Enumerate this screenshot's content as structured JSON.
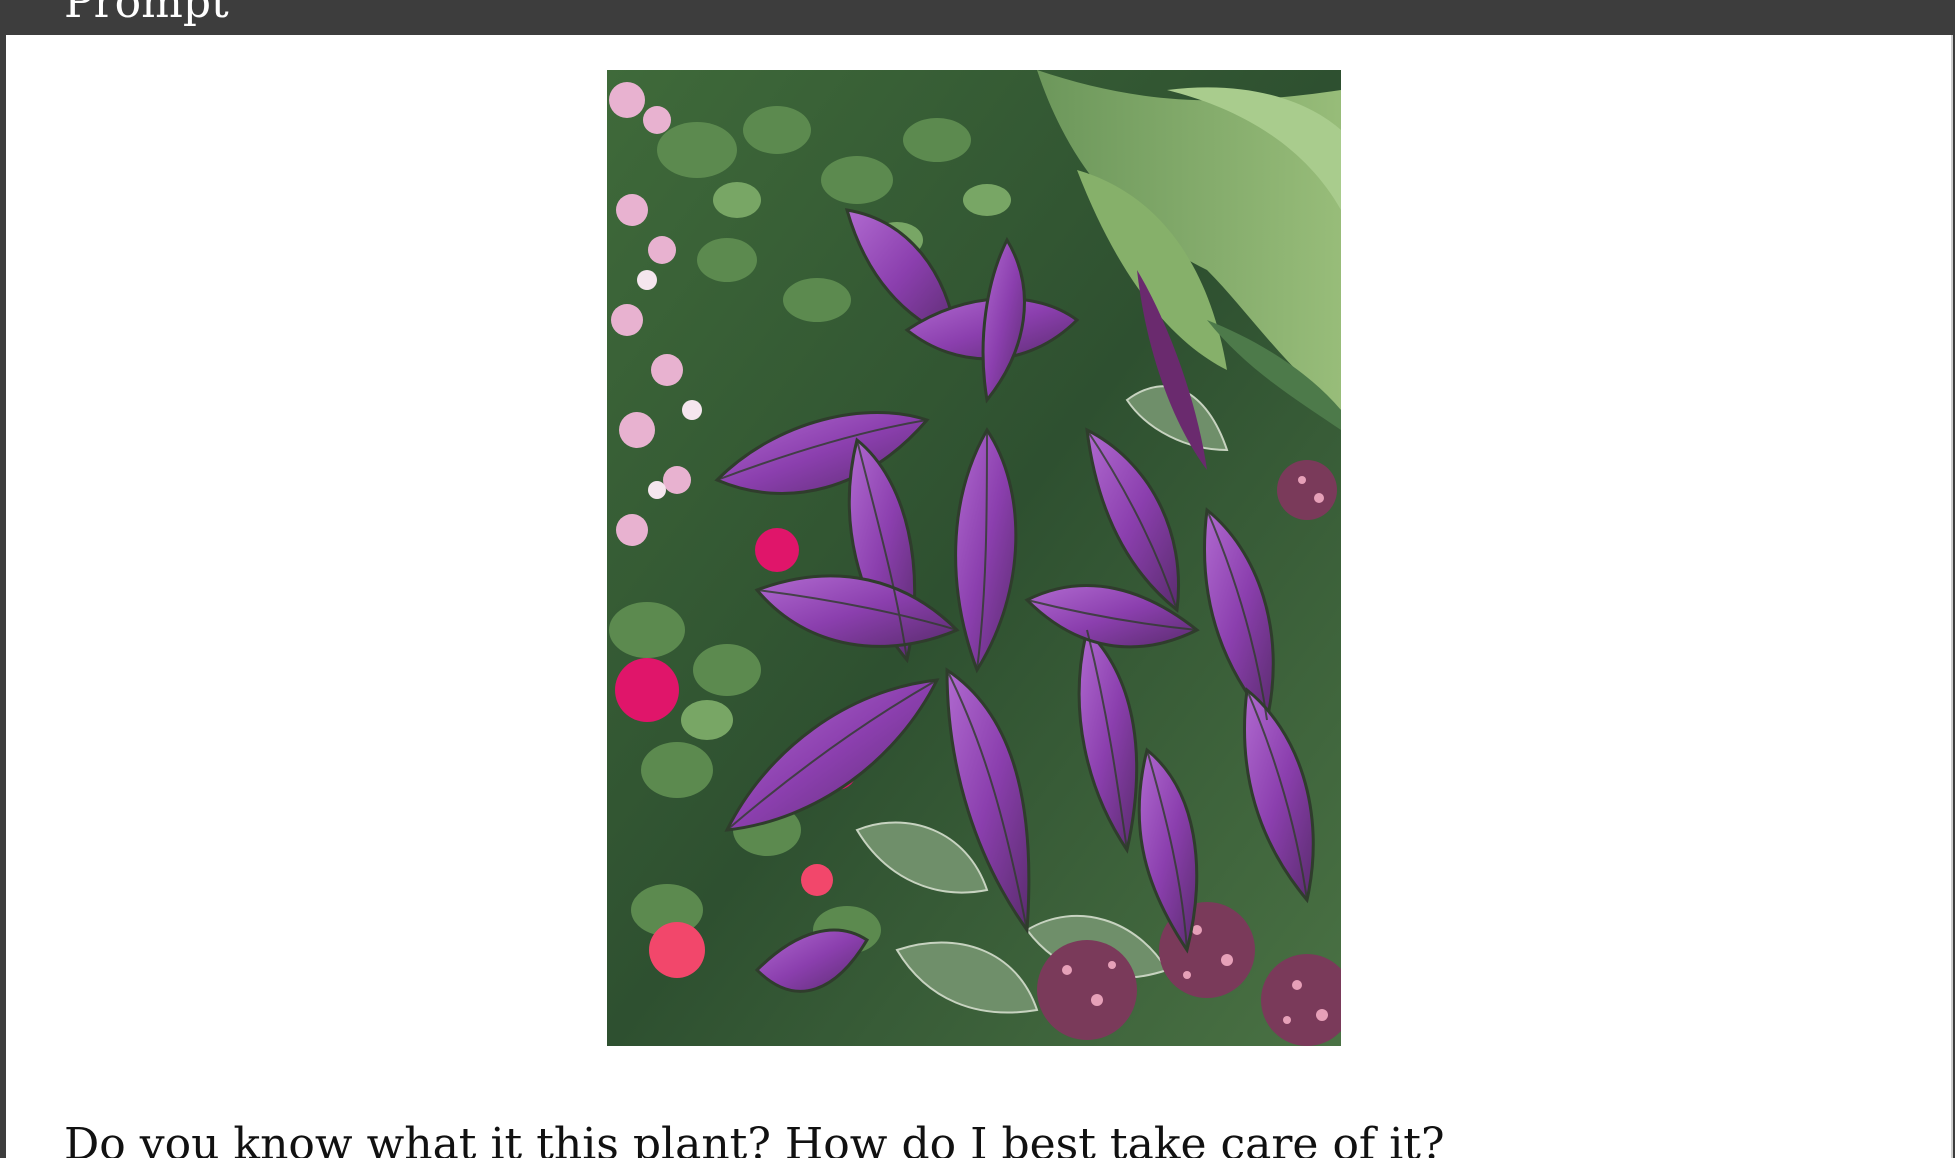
{
  "header": {
    "title": "Prompt"
  },
  "image": {
    "alt": "Photograph of a purple-leaved plant surrounded by green foliage and pink flowers"
  },
  "prompt": {
    "text": "Do you know what it this plant? How do I best take care of it?"
  },
  "colors": {
    "header_bg": "#3d3d3d",
    "panel_bg": "#ffffff",
    "leaf_purple": "#8a3fa8",
    "leaf_dark": "#2f3d2c",
    "foliage_green": "#4f7a45",
    "flower_pink": "#e0156a",
    "flower_light_pink": "#e8a7c9"
  }
}
